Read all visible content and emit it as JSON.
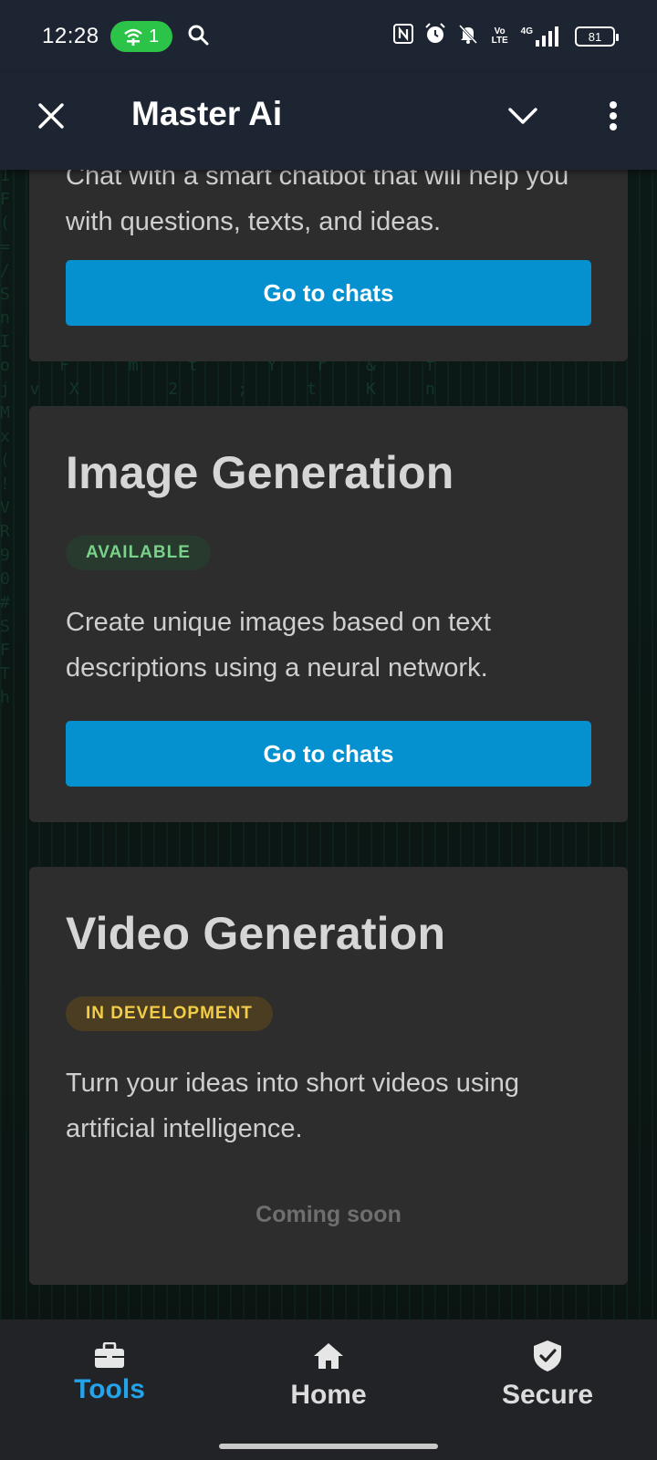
{
  "status_bar": {
    "time": "12:28",
    "hotspot_count": "1",
    "network": "4G",
    "volte": "Vo LTE",
    "battery": "81"
  },
  "app_bar": {
    "title": "Master Ai"
  },
  "cards": [
    {
      "description": "Chat with a smart chatbot that will help you with questions, texts, and ideas.",
      "button_label": "Go to chats"
    },
    {
      "title": "Image Generation",
      "badge": "AVAILABLE",
      "description": "Create unique images based on text descriptions using a neural network.",
      "button_label": "Go to chats"
    },
    {
      "title": "Video Generation",
      "badge": "IN DEVELOPMENT",
      "description": "Turn your ideas into short videos using artificial intelligence.",
      "footer": "Coming soon"
    }
  ],
  "bottom_nav": {
    "items": [
      {
        "label": "Tools",
        "icon": "briefcase-icon",
        "active": true
      },
      {
        "label": "Home",
        "icon": "home-icon",
        "active": false
      },
      {
        "label": "Secure",
        "icon": "shield-check-icon",
        "active": false
      }
    ]
  },
  "colors": {
    "accent": "#0590d0",
    "active_tab": "#24a3ea",
    "available_badge": "#79d28a",
    "dev_badge": "#f3cd48",
    "card_bg": "#2d2d2d",
    "header_bg": "#1d2532"
  }
}
